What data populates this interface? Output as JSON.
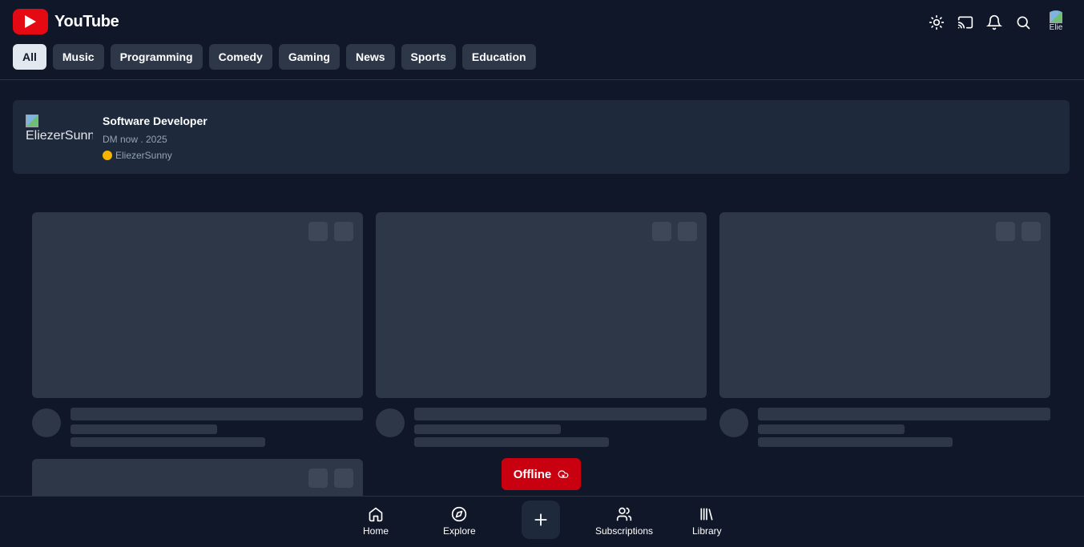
{
  "header": {
    "brand": "YouTube",
    "avatar_alt": "Elie"
  },
  "chips": [
    "All",
    "Music",
    "Programming",
    "Comedy",
    "Gaming",
    "News",
    "Sports",
    "Education"
  ],
  "channel_card": {
    "image_alt": "EliezerSunn",
    "title": "Software Developer",
    "meta": "DM now . 2025",
    "username": "EliezerSunny",
    "status_color": "#f5b400"
  },
  "offline_toast": {
    "label": "Offline"
  },
  "bottom_nav": {
    "home": "Home",
    "explore": "Explore",
    "subscriptions": "Subscriptions",
    "library": "Library"
  },
  "colors": {
    "background": "#0f1729",
    "surface": "#1e293b",
    "skeleton": "#2d3748",
    "brand_red": "#e50914",
    "offline_red": "#c8000f"
  }
}
